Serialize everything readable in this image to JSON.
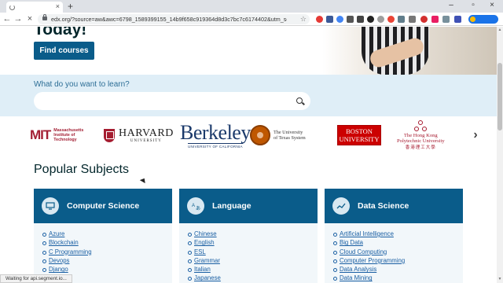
{
  "browser": {
    "address": "edx.org/?source=aw&awc=6798_1589399155_14b9f658c919364d8d3c7bc7c6174402&utm_source=aw&...",
    "status": "Waiting for api.segment.io..."
  },
  "hero": {
    "title_partial": "Today!",
    "cta_label": "Find courses"
  },
  "search": {
    "label": "What do you want to learn?",
    "value": "",
    "placeholder": ""
  },
  "partners": [
    {
      "name": "MIT",
      "mark": "MIT",
      "text": "Massachusetts\nInstitute of\nTechnology"
    },
    {
      "name": "Harvard",
      "main": "HARVARD",
      "sub": "UNIVERSITY"
    },
    {
      "name": "Berkeley",
      "main": "Berkeley",
      "sub": "UNIVERSITY OF CALIFORNIA"
    },
    {
      "name": "UT",
      "text": "The University\nof Texas System"
    },
    {
      "name": "Boston",
      "line1": "BOSTON",
      "line2": "UNIVERSITY"
    },
    {
      "name": "PolyU",
      "main": "The Hong Kong\nPolytechnic University",
      "cn": "香港理工大學"
    }
  ],
  "subjects": {
    "title": "Popular Subjects",
    "cards": [
      {
        "title": "Computer Science",
        "icon": "monitor-icon",
        "items": [
          "Azure",
          "Blockchain",
          "C Programming",
          "Devops",
          "Django"
        ]
      },
      {
        "title": "Language",
        "icon": "translate-icon",
        "items": [
          "Chinese",
          "English",
          "ESL",
          "Grammar",
          "Italian",
          "Japanese"
        ]
      },
      {
        "title": "Data Science",
        "icon": "chart-icon",
        "items": [
          "Artificial Intelligence",
          "Big Data",
          "Cloud Computing",
          "Computer Programming",
          "Data Analysis",
          "Data Mining"
        ]
      }
    ]
  },
  "colors": {
    "brand_blue": "#0a5c8a",
    "search_band": "#dfeef7",
    "link": "#1a5fa3"
  }
}
